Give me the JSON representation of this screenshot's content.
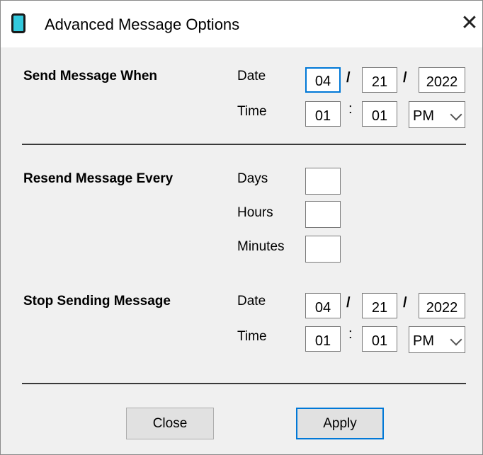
{
  "window": {
    "title": "Advanced Message Options",
    "close_glyph": "✕"
  },
  "send_when": {
    "heading": "Send Message When",
    "date_label": "Date",
    "time_label": "Time",
    "month": "04",
    "day": "21",
    "year": "2022",
    "date_sep": "/",
    "hour": "01",
    "minute": "01",
    "time_sep": ":",
    "ampm": "PM"
  },
  "resend_every": {
    "heading": "Resend Message Every",
    "days_label": "Days",
    "hours_label": "Hours",
    "minutes_label": "Minutes",
    "days": "",
    "hours": "",
    "minutes": ""
  },
  "stop_sending": {
    "heading": "Stop Sending Message",
    "date_label": "Date",
    "time_label": "Time",
    "month": "04",
    "day": "21",
    "year": "2022",
    "date_sep": "/",
    "hour": "01",
    "minute": "01",
    "time_sep": ":",
    "ampm": "PM"
  },
  "buttons": {
    "close": "Close",
    "apply": "Apply"
  },
  "colors": {
    "accent": "#0078d7",
    "icon": "#33c9dd",
    "dialog_bg": "#f0f0f0"
  }
}
